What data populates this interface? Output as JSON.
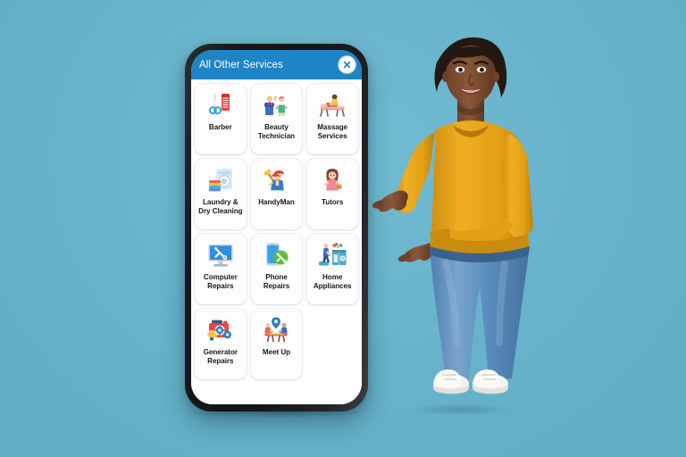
{
  "background": {
    "color": "#68b4cc"
  },
  "phone": {
    "frame_color": "#16181b",
    "screen_color": "#ffffff"
  },
  "app": {
    "header": {
      "title": "All Other Services",
      "background_color": "#1f84c6",
      "text_color": "#ffffff",
      "close_icon": "close-x-icon"
    },
    "grid": {
      "columns": 3,
      "tiles": [
        {
          "label": "Barber",
          "icon": "scissors-comb-icon"
        },
        {
          "label": "Beauty Technician",
          "icon": "salon-stylist-icon"
        },
        {
          "label": "Massage Services",
          "icon": "massage-table-icon"
        },
        {
          "label": "Laundry & Dry Cleaning",
          "icon": "washing-machine-laundry-icon"
        },
        {
          "label": "HandyMan",
          "icon": "worker-hammer-icon"
        },
        {
          "label": "Tutors",
          "icon": "tutor-book-icon"
        },
        {
          "label": "Computer Repairs",
          "icon": "desktop-tools-icon"
        },
        {
          "label": "Phone Repairs",
          "icon": "smartphone-tools-icon"
        },
        {
          "label": "Home Appliances",
          "icon": "kitchen-appliances-icon"
        },
        {
          "label": "Generator Repairs",
          "icon": "generator-icon"
        },
        {
          "label": "Meet Up",
          "icon": "people-table-pin-icon"
        }
      ]
    }
  },
  "model": {
    "description": "Smiling woman pointing toward phone",
    "sweater_color": "#e8a317",
    "jeans_color": "#5b8fc0",
    "shoes_color": "#f2f0ee",
    "skin_color": "#7b4b30"
  }
}
